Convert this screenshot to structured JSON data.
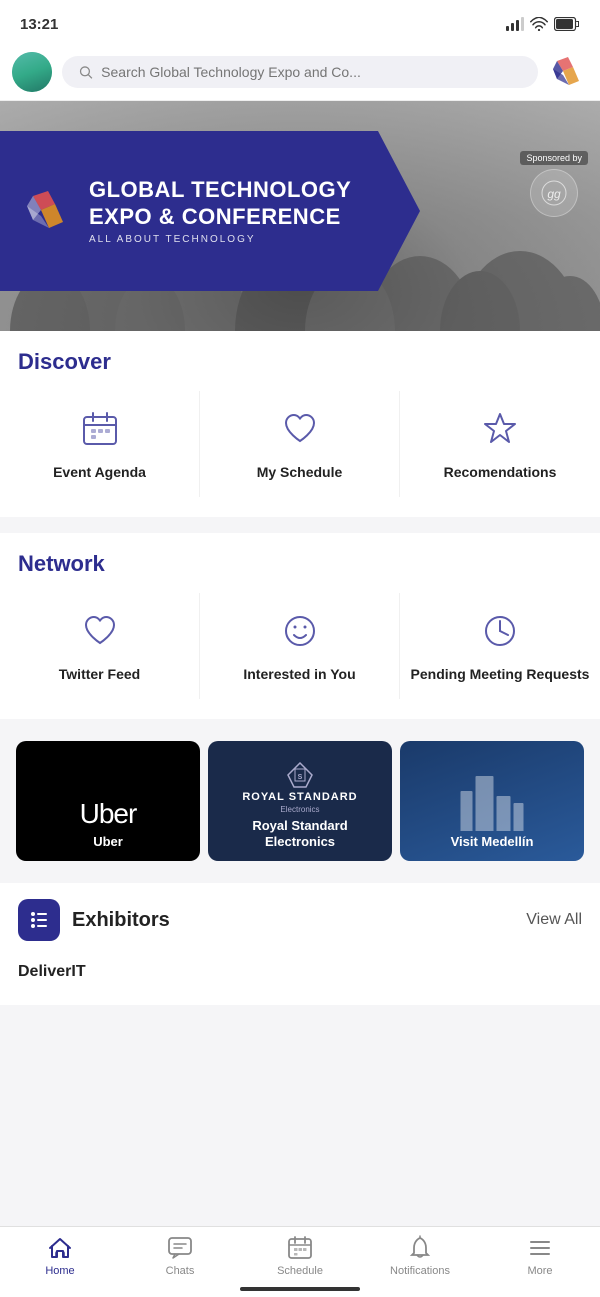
{
  "statusBar": {
    "time": "13:21"
  },
  "searchBar": {
    "placeholder": "Search Global Technology Expo and Co..."
  },
  "hero": {
    "title": "GLOBAL TECHNOLOGY EXPO & CONFERENCE",
    "subtitle": "ALL ABOUT TECHNOLOGY",
    "sponsoredLabel": "Sponsored by"
  },
  "discover": {
    "sectionTitle": "Discover",
    "items": [
      {
        "label": "Event Agenda",
        "icon": "calendar-icon"
      },
      {
        "label": "My Schedule",
        "icon": "heart-icon"
      },
      {
        "label": "Recomendations",
        "icon": "star-icon"
      }
    ]
  },
  "network": {
    "sectionTitle": "Network",
    "items": [
      {
        "label": "Twitter Feed",
        "icon": "heart-outline-icon"
      },
      {
        "label": "Interested in You",
        "icon": "smiley-icon"
      },
      {
        "label": "Pending Meeting Requests",
        "icon": "clock-icon"
      }
    ]
  },
  "partners": [
    {
      "name": "Uber",
      "type": "uber"
    },
    {
      "name": "Royal Standard Electronics",
      "type": "royal"
    },
    {
      "name": "Visit Medellín",
      "type": "medellin"
    }
  ],
  "exhibitors": {
    "title": "Exhibitors",
    "viewAll": "View All",
    "items": [
      {
        "name": "DeliverIT"
      }
    ]
  },
  "bottomNav": {
    "items": [
      {
        "label": "Home",
        "icon": "home-icon",
        "active": true
      },
      {
        "label": "Chats",
        "icon": "chat-icon",
        "active": false
      },
      {
        "label": "Schedule",
        "icon": "schedule-icon",
        "active": false
      },
      {
        "label": "Notifications",
        "icon": "bell-icon",
        "active": false
      },
      {
        "label": "More",
        "icon": "more-icon",
        "active": false
      }
    ]
  }
}
